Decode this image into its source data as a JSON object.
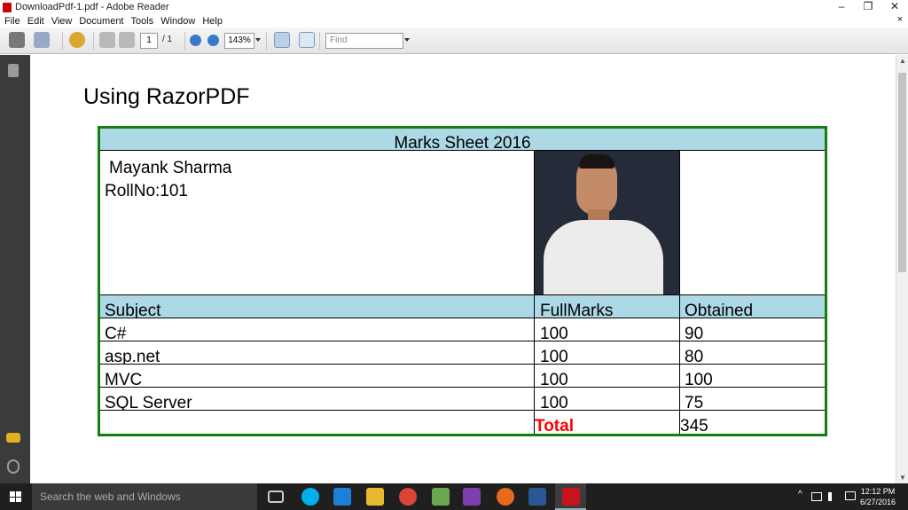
{
  "window": {
    "title": "DownloadPdf-1.pdf - Adobe Reader",
    "minimize": "–",
    "maximize": "❐",
    "close": "✕",
    "close_doc": "×"
  },
  "menu": [
    "File",
    "Edit",
    "View",
    "Document",
    "Tools",
    "Window",
    "Help"
  ],
  "toolbar": {
    "page_current": "1",
    "page_total": "/ 1",
    "zoom": "143%",
    "find_placeholder": "Find"
  },
  "document": {
    "heading": "Using RazorPDF",
    "sheet_title": "Marks Sheet 2016",
    "student_name": "Mayank Sharma",
    "roll_no": "RollNo:101",
    "headers": [
      "Subject",
      "FullMarks",
      "Obtained"
    ],
    "rows": [
      {
        "subject": "C#",
        "full": "100",
        "obtained": "90"
      },
      {
        "subject": "asp.net",
        "full": "100",
        "obtained": "80"
      },
      {
        "subject": "MVC",
        "full": "100",
        "obtained": "100"
      },
      {
        "subject": "SQL Server",
        "full": "100",
        "obtained": "75"
      }
    ],
    "total_label": "Total",
    "total_value": "345"
  },
  "taskbar": {
    "search_placeholder": "Search the web and Windows",
    "time": "12:12 PM",
    "date": "6/27/2016"
  },
  "colors": {
    "table_border": "#108010",
    "header_bg": "#add8e6",
    "total_label": "#ff0000"
  }
}
